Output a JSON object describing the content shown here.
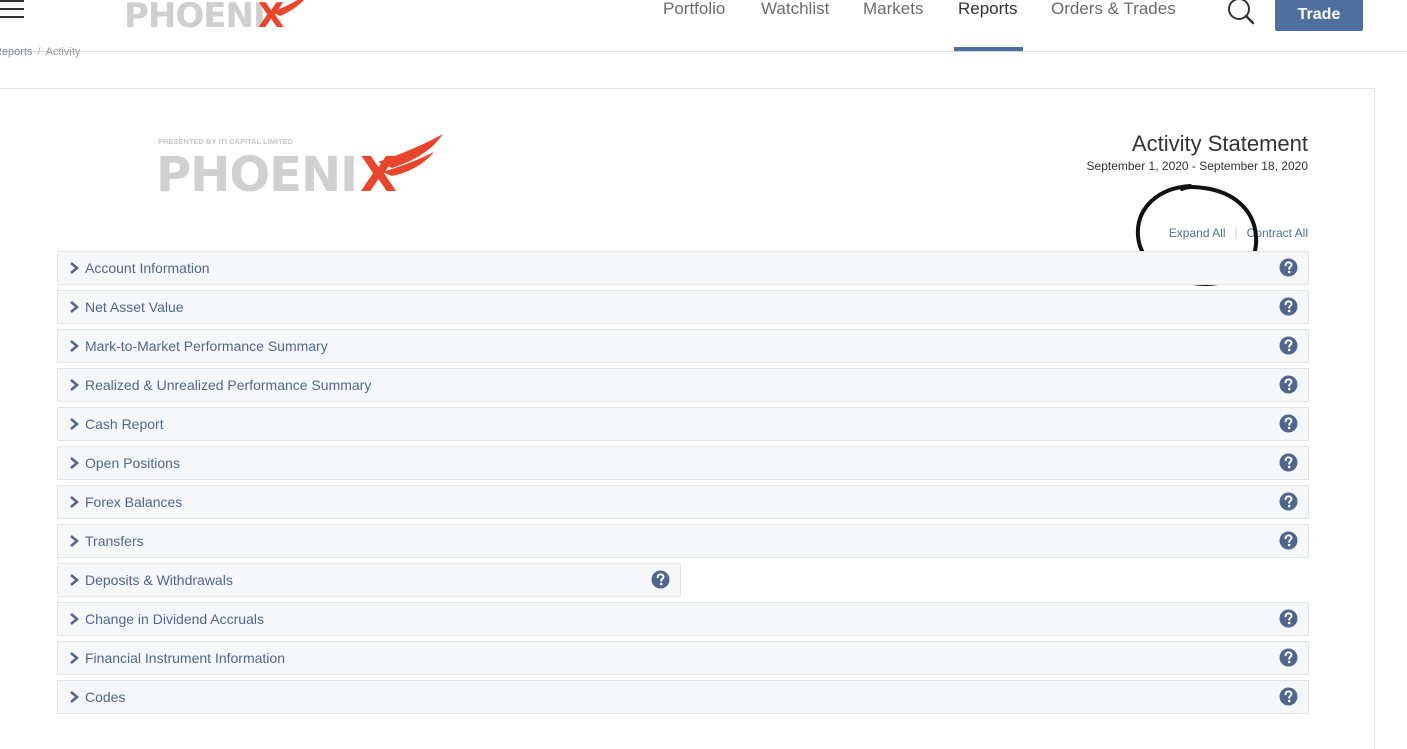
{
  "brand": {
    "logo_text_part1": "PHOENI",
    "logo_text_part2": "X",
    "presented_by": "PRESENTED BY ITI CAPITAL LIMITED"
  },
  "nav": {
    "items": [
      {
        "label": "Portfolio",
        "active": false
      },
      {
        "label": "Watchlist",
        "active": false
      },
      {
        "label": "Markets",
        "active": false
      },
      {
        "label": "Reports",
        "active": true
      },
      {
        "label": "Orders & Trades",
        "active": false
      }
    ],
    "trade_label": "Trade"
  },
  "breadcrumb": {
    "parent": "Reports",
    "separator": "/",
    "current": "Activity"
  },
  "statement": {
    "title": "Activity Statement",
    "period": "September 1, 2020 - September 18, 2020",
    "expand_all": "Expand All",
    "separator": "|",
    "contract_all": "Contract All"
  },
  "sections": [
    {
      "label": "Account Information"
    },
    {
      "label": "Net Asset Value"
    },
    {
      "label": "Mark-to-Market Performance Summary"
    },
    {
      "label": "Realized & Unrealized Performance Summary"
    },
    {
      "label": "Cash Report"
    },
    {
      "label": "Open Positions"
    },
    {
      "label": "Forex Balances"
    },
    {
      "label": "Transfers"
    },
    {
      "label": "Deposits & Withdrawals"
    },
    {
      "label": "Change in Dividend Accruals"
    },
    {
      "label": "Financial Instrument Information"
    },
    {
      "label": "Codes"
    }
  ],
  "colors": {
    "accent": "#4f6fa0",
    "logo_gray": "#cfcfcf",
    "logo_red": "#e8452c",
    "section_text": "#4f6790",
    "annotation": "#111111"
  }
}
